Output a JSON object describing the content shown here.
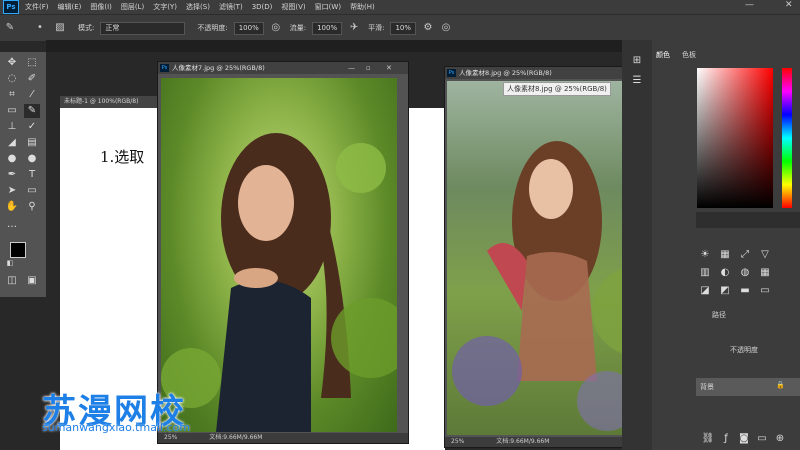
{
  "menubar": {
    "logo": "Ps",
    "items": [
      "文件(F)",
      "编辑(E)",
      "图像(I)",
      "图层(L)",
      "文字(Y)",
      "选择(S)",
      "滤镜(T)",
      "3D(D)",
      "视图(V)",
      "窗口(W)",
      "帮助(H)"
    ],
    "minimize": "—",
    "close": "✕"
  },
  "options": {
    "mode_label": "模式:",
    "mode_value": "正常",
    "opacity_label": "不透明度:",
    "opacity_value": "100%",
    "flow_label": "流量:",
    "flow_value": "100%",
    "smoothing_label": "平滑:",
    "smoothing_value": "10%"
  },
  "documents": {
    "untitled": {
      "title": "未标题-1 @ 100%(RGB/8)",
      "handwriting": "1.选取"
    },
    "doc7": {
      "title": "人像素材7.jpg @ 25%(RGB/8)",
      "zoom": "25%",
      "docsize": "文档:9.66M/9.66M"
    },
    "doc8": {
      "title": "人像素材8.jpg @ 25%(RGB/8)",
      "zoom": "25%",
      "docsize": "文档:9.66M/9.66M",
      "tooltip": "人像素材8.jpg @ 25%(RGB/8)"
    }
  },
  "panels": {
    "color_tab": "颜色",
    "swatches_tab": "色板",
    "history_tab": "路径",
    "opacity_label": "不透明度",
    "layer_name": "背景"
  },
  "watermark": {
    "brand": "苏漫网校",
    "url": "sumanwangxiao.tmall.com"
  },
  "colors": {
    "brand_blue": "#1e7fe6",
    "ps_blue": "#31a8ff",
    "foreground": "#000000",
    "background": "#ffffff"
  }
}
